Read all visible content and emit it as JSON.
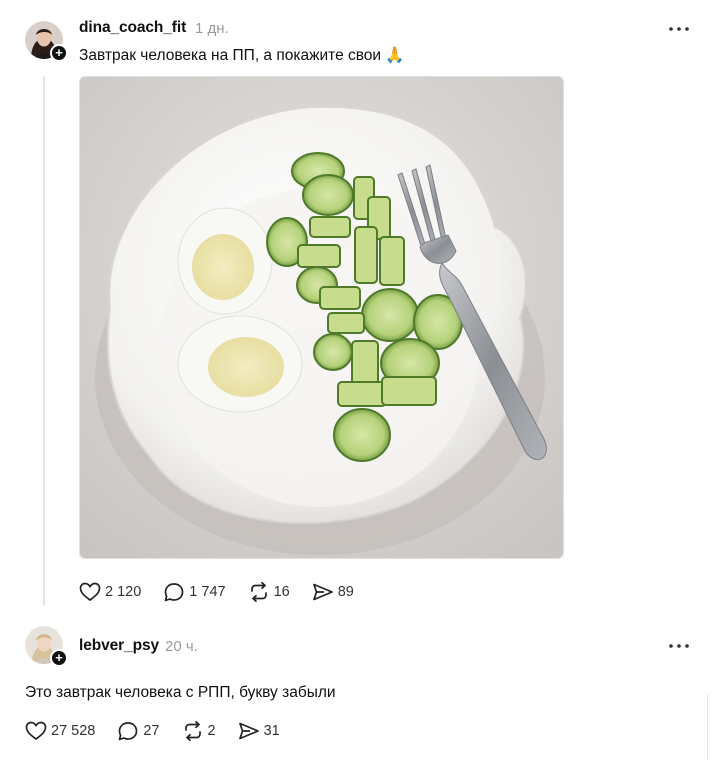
{
  "posts": [
    {
      "username": "dina_coach_fit",
      "time": "1 дн.",
      "text": "Завтрак человека на ПП, а покажите свои",
      "emoji": "🙏",
      "image_alt": "plate with boiled eggs and cucumbers",
      "stats": {
        "likes": "2 120",
        "comments": "1 747",
        "reposts": "16",
        "shares": "89"
      }
    },
    {
      "username": "lebver_psy",
      "time": "20 ч.",
      "text": "Это завтрак человека с РПП, букву забыли",
      "stats": {
        "likes": "27 528",
        "comments": "27",
        "reposts": "2",
        "shares": "31"
      }
    }
  ],
  "icons": {
    "like": "heart-icon",
    "comment": "speech-bubble-icon",
    "repost": "repost-arrows-icon",
    "share": "send-icon",
    "more": "more-dots-icon",
    "follow": "plus-icon"
  },
  "colors": {
    "text": "#101010",
    "muted": "#9a9a9a",
    "thread_line": "#e3e3e3"
  }
}
